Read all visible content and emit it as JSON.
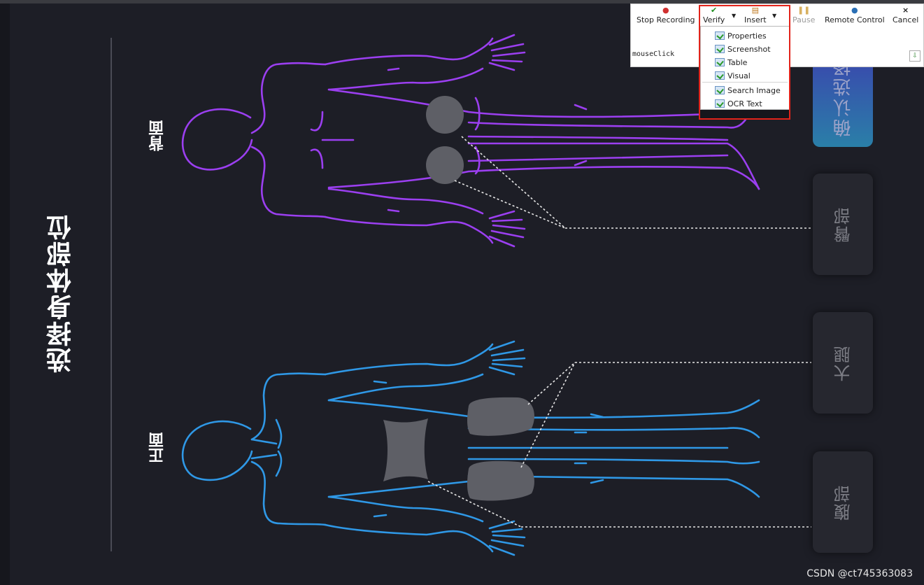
{
  "page": {
    "title": "选择身体部位",
    "back_label": "背面",
    "front_label": "正面"
  },
  "colors": {
    "back_outline": "#9b3ff0",
    "front_outline": "#2f98e6",
    "area_fill": "#5e5f66",
    "connector": "#e6e6e6"
  },
  "body_parts": [
    {
      "label": "臀部"
    },
    {
      "label": "大腿"
    },
    {
      "label": "腹部"
    }
  ],
  "confirm_button": {
    "label": "确认选择"
  },
  "recorder": {
    "buttons": [
      {
        "label": "Stop Recording",
        "icon": "record-stop-icon",
        "enabled": true
      },
      {
        "label": "Verify",
        "icon": "checkmark-icon",
        "enabled": true,
        "has_dropdown": true
      },
      {
        "label": "Insert",
        "icon": "insert-icon",
        "enabled": true,
        "has_dropdown": true
      },
      {
        "label": "Pause",
        "icon": "pause-icon",
        "enabled": false
      },
      {
        "label": "Remote Control",
        "icon": "globe-icon",
        "enabled": true
      },
      {
        "label": "Cancel",
        "icon": "close-icon",
        "enabled": true
      }
    ],
    "status_text": "mouseClick",
    "verify_menu": [
      "Properties",
      "Screenshot",
      "Table",
      "Visual",
      "Search Image",
      "OCR Text"
    ]
  },
  "watermark": "CSDN @ct745363083"
}
